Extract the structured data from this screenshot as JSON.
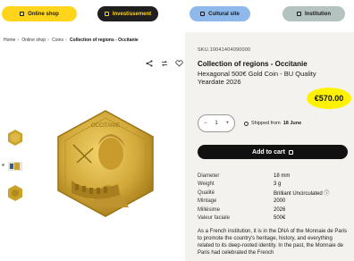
{
  "nav": {
    "shop": "Online shop",
    "investment": "Investissement",
    "cultural": "Cultural site",
    "institution": "Institution"
  },
  "breadcrumb": [
    "Home",
    "Online shop",
    "Coins",
    "Collection of regions - Occitanie"
  ],
  "product": {
    "sku": "SKU.10041404090000",
    "title": "Collection of regions - Occitanie",
    "subtitle": "Hexagonal 500€ Gold Coin - BU Quality Yeardate 2026",
    "price": "€570.00",
    "qty_minus": "−",
    "qty_value": "1",
    "qty_plus": "+",
    "shipping_prefix": "Shipped from",
    "shipping_date": "18 June",
    "cart_label": "Add to cart",
    "coin_text": "OCCITANIE"
  },
  "specs": [
    {
      "k": "Diameter",
      "v": "18 mm"
    },
    {
      "k": "Weight",
      "v": "3 g"
    },
    {
      "k": "Qualité",
      "v": "Brilliant Uncirculated ⓘ"
    },
    {
      "k": "Mintage",
      "v": "2000"
    },
    {
      "k": "Millésime",
      "v": "2026"
    },
    {
      "k": "Valeur faciale",
      "v": "500€"
    }
  ],
  "description": "As a French institution, it is in the DNA of the Monnaie de Paris to promote the country's heritage, history, and everything related to its deep-rooted identity. In the past, the Monnaie de Paris had celebrated the French",
  "colors": {
    "shop_pill": "#ffd51c",
    "investment_pill": "#1f1f1f",
    "cultural_pill": "#8fb9ea",
    "institution_pill": "#b4c2c0",
    "price_highlight": "#fff200",
    "gold": "#c9a227"
  },
  "icons": [
    "share-icon",
    "compare-icon",
    "heart-icon",
    "shop-icon",
    "investment-icon",
    "cultural-icon",
    "institution-icon",
    "check-icon",
    "bag-icon"
  ]
}
